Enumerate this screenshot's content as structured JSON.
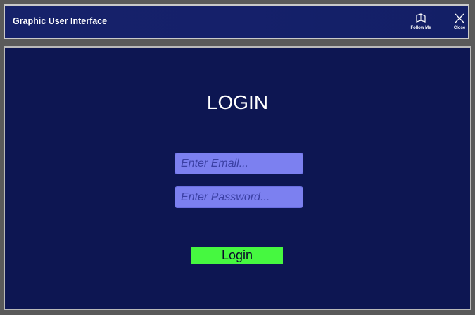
{
  "window": {
    "title": "Graphic User Interface",
    "buttons": {
      "follow_label": "Follow Me",
      "follow_icon": "pin-icon",
      "close_label": "Close",
      "close_icon": "close-icon"
    }
  },
  "login": {
    "heading": "LOGIN",
    "email_placeholder": "Enter Email...",
    "password_placeholder": "Enter Password...",
    "button_label": "Login"
  },
  "colors": {
    "titlebar": "#15206a",
    "panel": "#0d1652",
    "input": "#7c80f0",
    "button": "#46f840"
  }
}
